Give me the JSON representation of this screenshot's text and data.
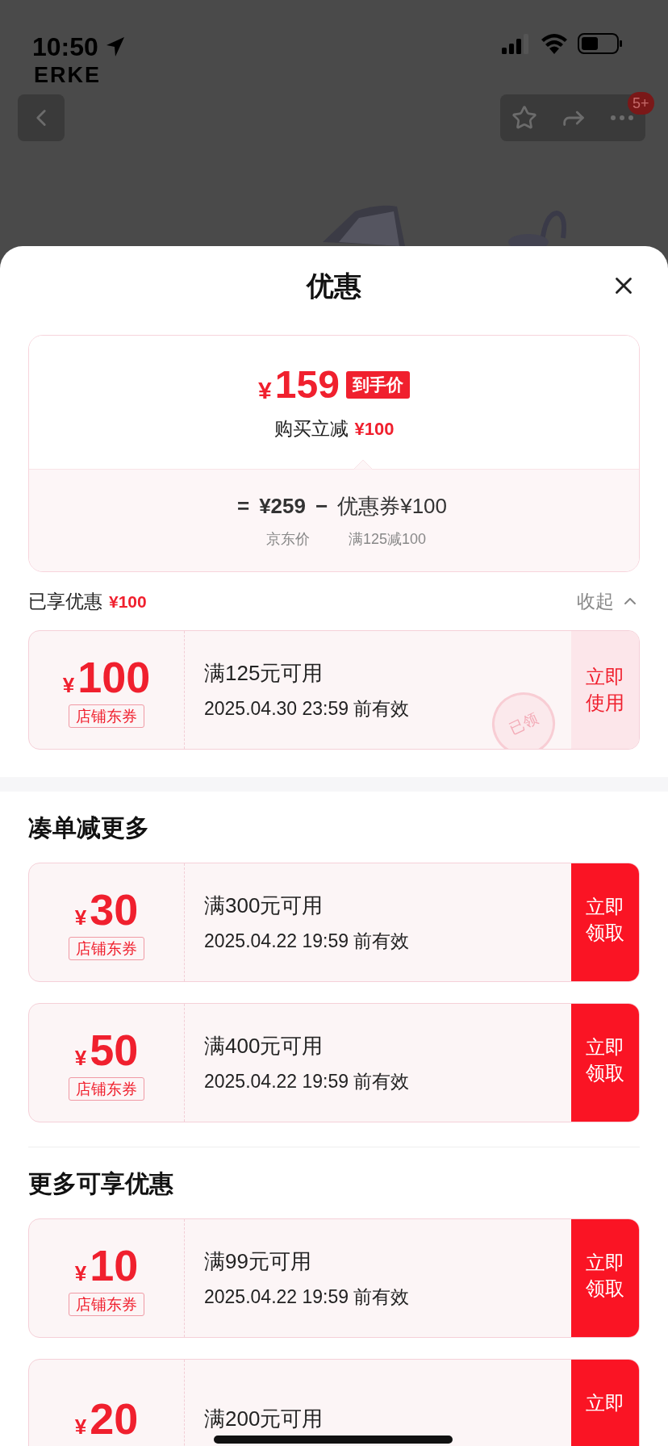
{
  "status_bar": {
    "time": "10:50"
  },
  "background": {
    "brand": "ERKE",
    "badge": "5+"
  },
  "sheet": {
    "title": "优惠"
  },
  "price_card": {
    "currency": "¥",
    "final_price": "159",
    "final_label": "到手价",
    "instant_text": "购买立减",
    "instant_amount": "¥100",
    "equals": "=",
    "base_price": "¥259",
    "minus": "−",
    "coupon_part": "优惠券¥100",
    "base_label": "京东价",
    "coupon_rule": "满125减100"
  },
  "enjoyed": {
    "label": "已享优惠",
    "amount": "¥100",
    "toggle": "收起",
    "expanded": true
  },
  "sections": [
    {
      "coupons": [
        {
          "currency": "¥",
          "amount": "100",
          "tag": "店铺东券",
          "condition": "满125元可用",
          "validity": "2025.04.30 23:59 前有效",
          "action": "立即使用",
          "claimed": true,
          "stamp": "已领"
        }
      ]
    },
    {
      "title": "凑单减更多",
      "coupons": [
        {
          "currency": "¥",
          "amount": "30",
          "tag": "店铺东券",
          "condition": "满300元可用",
          "validity": "2025.04.22 19:59 前有效",
          "action": "立即领取",
          "claimed": false
        },
        {
          "currency": "¥",
          "amount": "50",
          "tag": "店铺东券",
          "condition": "满400元可用",
          "validity": "2025.04.22 19:59 前有效",
          "action": "立即领取",
          "claimed": false
        }
      ]
    },
    {
      "title": "更多可享优惠",
      "coupons": [
        {
          "currency": "¥",
          "amount": "10",
          "tag": "店铺东券",
          "condition": "满99元可用",
          "validity": "2025.04.22 19:59 前有效",
          "action": "立即领取",
          "claimed": false
        },
        {
          "currency": "¥",
          "amount": "20",
          "condition": "满200元可用",
          "action": "立即",
          "claimed": false
        }
      ]
    }
  ]
}
